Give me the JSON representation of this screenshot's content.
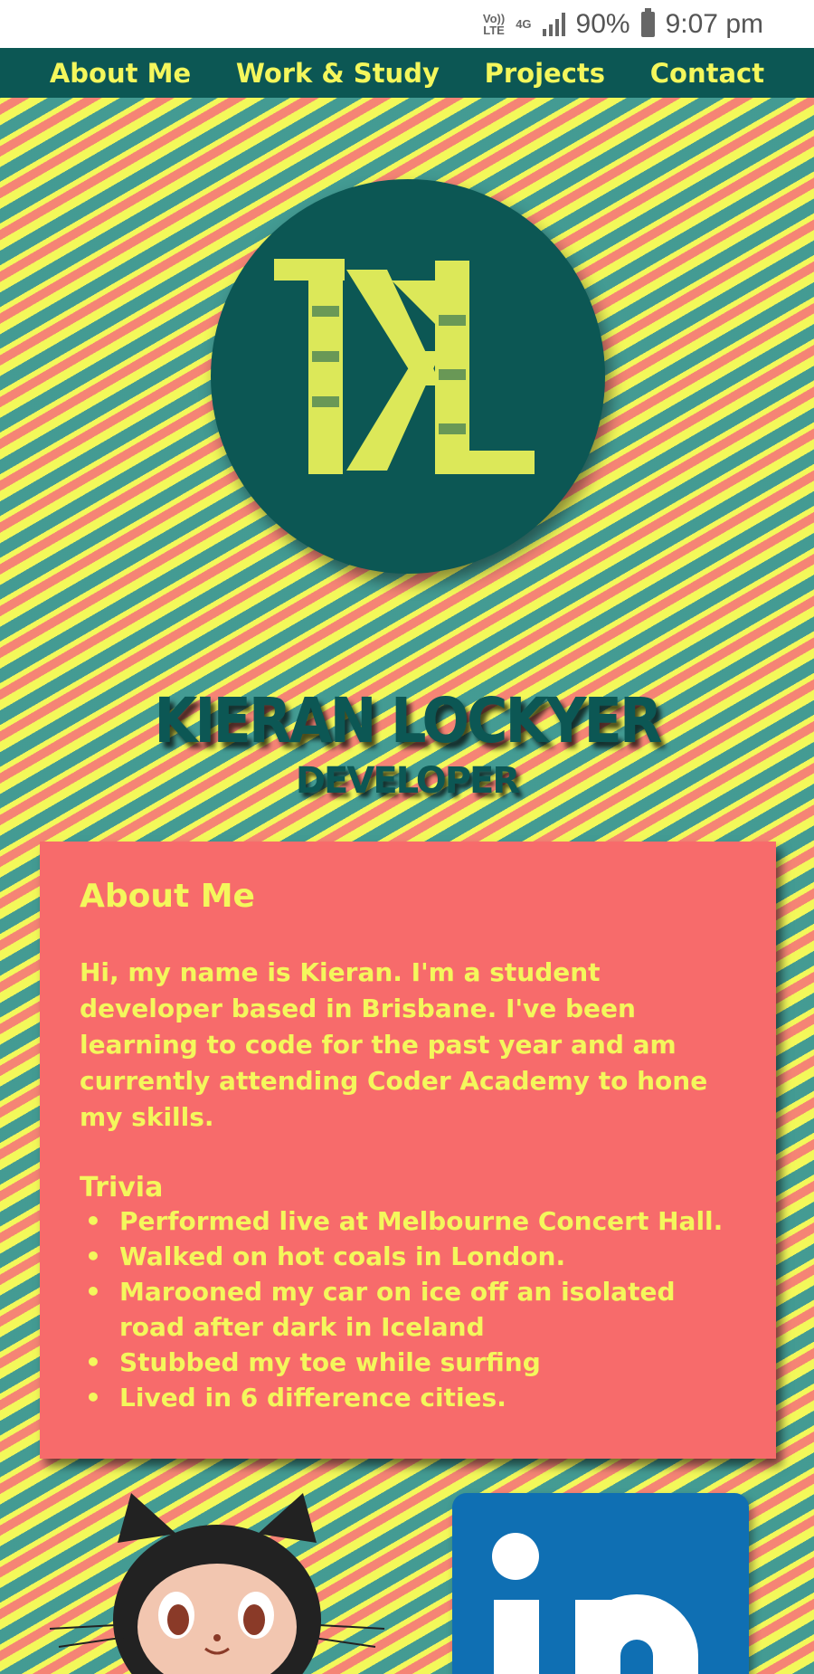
{
  "status_bar": {
    "network_top": "Vo))",
    "network_bottom": "LTE",
    "data_type": "4G",
    "battery": "90%",
    "time": "9:07 pm"
  },
  "nav": {
    "items": [
      {
        "label": "About Me"
      },
      {
        "label": "Work & Study"
      },
      {
        "label": "Projects"
      },
      {
        "label": "Contact"
      }
    ]
  },
  "hero": {
    "name": "KIERAN LOCKYER",
    "role": "DEVELOPER"
  },
  "about": {
    "title": "About Me",
    "intro": "Hi, my name is Kieran. I'm a student developer based in Brisbane. I've been learning to code for the past year and am currently attending Coder Academy to hone my skills.",
    "trivia_title": "Trivia",
    "trivia": [
      "Performed live at Melbourne Concert Hall.",
      "Walked on hot coals in London.",
      "Marooned my car on ice off an isolated road after dark in Iceland",
      "Stubbed my toe while surfing",
      "Lived in 6 difference cities."
    ]
  },
  "social": {
    "linkedin_glyph": "in"
  },
  "colors": {
    "teal": "#0c5754",
    "yellow": "#f4f75c",
    "coral": "#f76b6b",
    "linkedin_blue": "#0f6fb3"
  }
}
